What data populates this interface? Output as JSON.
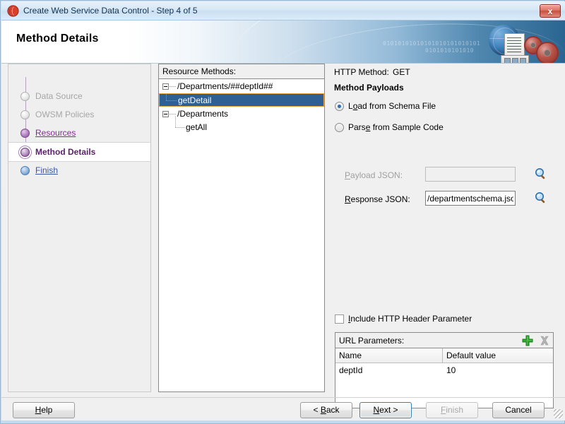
{
  "window": {
    "title": "Create Web Service Data Control - Step 4 of 5",
    "app_icon": "oracle-jdeveloper-icon",
    "close_label": "x"
  },
  "banner": {
    "heading": "Method Details",
    "binary_line_1": "01010101010101010101010101",
    "binary_line_2": "0101010101010"
  },
  "steps": [
    {
      "label": "Data Source",
      "state": "done"
    },
    {
      "label": "OWSM Policies",
      "state": "done"
    },
    {
      "label": "Resources",
      "state": "visited"
    },
    {
      "label": "Method Details",
      "state": "current"
    },
    {
      "label": "Finish",
      "state": "future"
    }
  ],
  "tree": {
    "header": "Resource Methods:",
    "nodes": [
      {
        "label": "/Departments/##deptId##",
        "type": "parent",
        "selected": false
      },
      {
        "label": "getDetail",
        "type": "child",
        "selected": true
      },
      {
        "label": "/Departments",
        "type": "parent",
        "selected": false
      },
      {
        "label": "getAll",
        "type": "child",
        "selected": false
      }
    ]
  },
  "detail": {
    "http_method_label": "HTTP Method:",
    "http_method_value": "GET",
    "payloads_heading": "Method Payloads",
    "radio_schema_label": "Load from Schema File",
    "radio_schema_mnemonic": "o",
    "radio_schema_selected": true,
    "radio_sample_label": "Parse from Sample Code",
    "radio_sample_mnemonic": "e",
    "radio_sample_selected": false,
    "payload_json_label": "Payload JSON:",
    "payload_json_value": "",
    "payload_json_disabled": true,
    "response_json_label": "Response JSON:",
    "response_json_value": "/departmentschema.json",
    "browse_icon": "magnifier-icon",
    "include_header_label": "Include HTTP Header Parameter",
    "include_header_checked": false
  },
  "url_params": {
    "title": "URL Parameters:",
    "add_icon": "plus-icon",
    "delete_icon": "delete-x-icon",
    "columns": [
      "Name",
      "Default value"
    ],
    "rows": [
      {
        "name": "deptId",
        "default_value": "10"
      }
    ]
  },
  "buttons": {
    "help": "Help",
    "back": "< Back",
    "next": "Next >",
    "finish": "Finish",
    "cancel": "Cancel"
  },
  "colors": {
    "selection_blue": "#2f6094",
    "focus_orange": "#e8a33d",
    "current_step_purple": "#5a1f6b",
    "link_purple": "#7e2f8e",
    "link_blue": "#3a55a5",
    "banner_blue": "#2a6591",
    "add_green": "#2fa82f",
    "close_red": "#c9503f"
  }
}
